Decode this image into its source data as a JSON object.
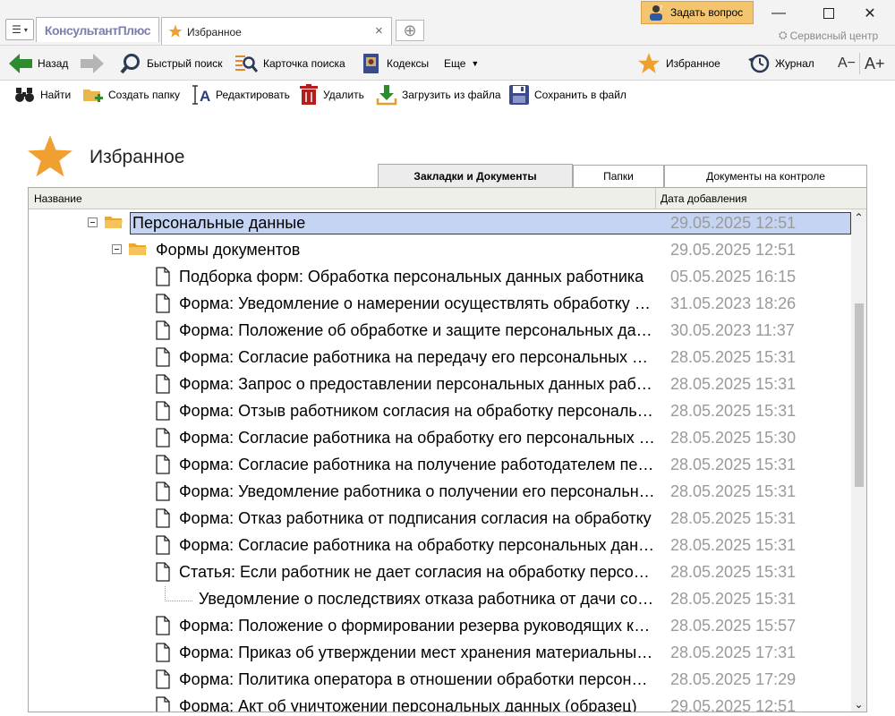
{
  "titlebar": {
    "logo": "КонсультантПлюс",
    "tab_label": "Избранное",
    "ask_button": "Задать вопрос",
    "service_center": "Сервисный центр"
  },
  "nav": {
    "back": "Назад",
    "quick_search": "Быстрый поиск",
    "search_card": "Карточка поиска",
    "codes": "Кодексы",
    "more": "Еще",
    "favorites": "Избранное",
    "journal": "Журнал",
    "font_smaller": "A−",
    "font_larger": "A+"
  },
  "actions": {
    "find": "Найти",
    "create_folder": "Создать папку",
    "edit": "Редактировать",
    "delete": "Удалить",
    "load_file": "Загрузить из файла",
    "save_file": "Сохранить в файл"
  },
  "page": {
    "title": "Избранное"
  },
  "tabs": [
    {
      "label": "Закладки и Документы",
      "active": true
    },
    {
      "label": "Папки",
      "active": false
    },
    {
      "label": "Документы на контроле",
      "active": false
    }
  ],
  "table": {
    "col_name": "Название",
    "col_date": "Дата добавления",
    "rows": [
      {
        "type": "folder",
        "level": 0,
        "selected": true,
        "title": "Персональные данные",
        "date": "29.05.2025 12:51"
      },
      {
        "type": "folder",
        "level": 1,
        "selected": false,
        "title": "Формы документов",
        "date": "29.05.2025 12:51"
      },
      {
        "type": "doc",
        "level": 2,
        "title": "Подборка форм: Обработка персональных данных работника",
        "date": "05.05.2025 16:15"
      },
      {
        "type": "doc",
        "level": 2,
        "title": "Форма: Уведомление о намерении осуществлять обработку персональных данных",
        "date": "31.05.2023 18:26"
      },
      {
        "type": "doc",
        "level": 2,
        "title": "Форма: Положение об обработке и защите персональных данных работников",
        "date": "30.05.2023 11:37"
      },
      {
        "type": "doc",
        "level": 2,
        "title": "Форма: Согласие работника на передачу его персональных данных",
        "date": "28.05.2025 15:31"
      },
      {
        "type": "doc",
        "level": 2,
        "title": "Форма: Запрос о предоставлении персональных данных работника",
        "date": "28.05.2025 15:31"
      },
      {
        "type": "doc",
        "level": 2,
        "title": "Форма: Отзыв работником согласия на обработку персональных данных",
        "date": "28.05.2025 15:31"
      },
      {
        "type": "doc",
        "level": 2,
        "title": "Форма: Согласие работника на обработку его персональных данных",
        "date": "28.05.2025 15:30"
      },
      {
        "type": "doc",
        "level": 2,
        "title": "Форма: Согласие работника на получение работодателем персональных данных",
        "date": "28.05.2025 15:31"
      },
      {
        "type": "doc",
        "level": 2,
        "title": "Форма: Уведомление работника о получении его персональных данных",
        "date": "28.05.2025 15:31"
      },
      {
        "type": "doc",
        "level": 2,
        "title": "Форма: Отказ работника от подписания согласия на обработку",
        "date": "28.05.2025 15:31"
      },
      {
        "type": "doc",
        "level": 2,
        "title": "Форма: Согласие работника на обработку персональных данных",
        "date": "28.05.2025 15:31"
      },
      {
        "type": "doc",
        "level": 2,
        "title": "Статья: Если работник не дает согласия на обработку персональных данных",
        "date": "28.05.2025 15:31"
      },
      {
        "type": "bookmark",
        "level": 3,
        "title": "Уведомление о последствиях отказа работника от дачи согласия",
        "date": "28.05.2025 15:31"
      },
      {
        "type": "doc",
        "level": 2,
        "title": "Форма: Положение о формировании резерва руководящих кадров",
        "date": "28.05.2025 15:57"
      },
      {
        "type": "doc",
        "level": 2,
        "title": "Форма: Приказ об утверждении мест хранения материальных носителей",
        "date": "28.05.2025 17:31"
      },
      {
        "type": "doc",
        "level": 2,
        "title": "Форма: Политика оператора в отношении обработки персональных данных",
        "date": "28.05.2025 17:29"
      },
      {
        "type": "doc",
        "level": 2,
        "title": "Форма: Акт об уничтожении персональных данных (образец)",
        "date": "29.05.2025 12:51"
      }
    ]
  },
  "scrollbar": {
    "position_fraction": 0.27,
    "visible_fraction": 0.39
  }
}
